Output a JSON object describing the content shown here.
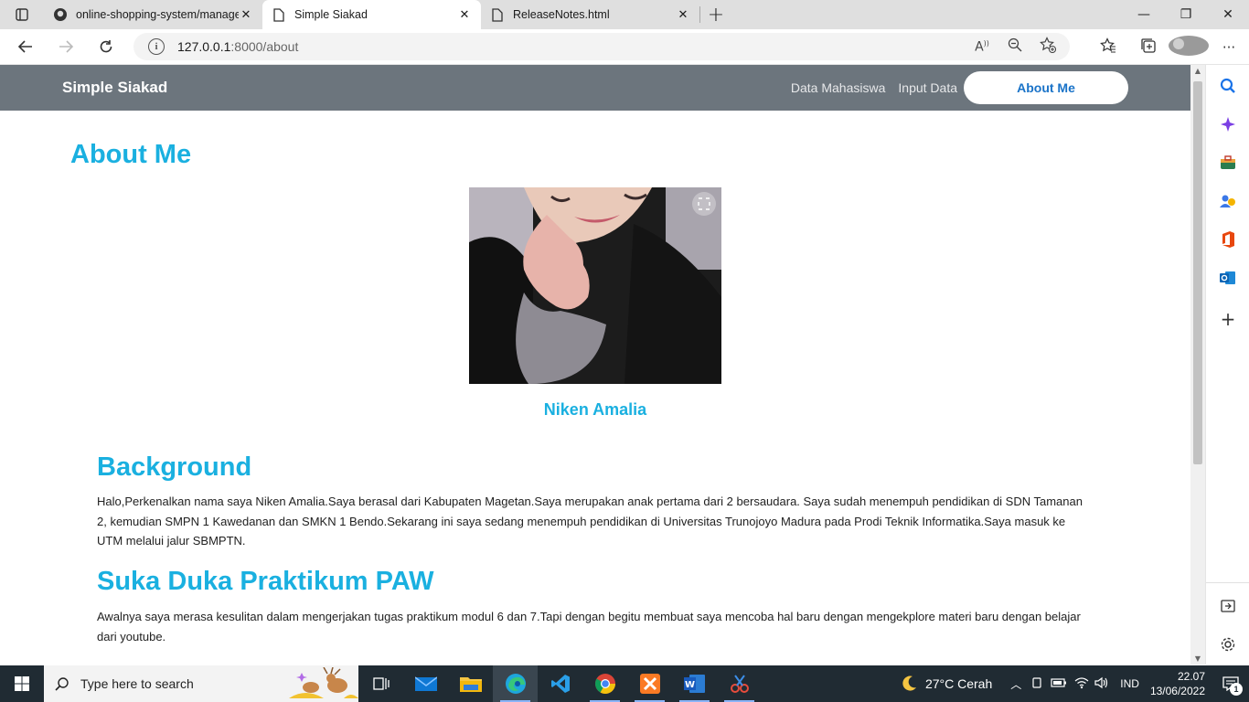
{
  "browser": {
    "tabs": [
      {
        "title": "online-shopping-system/manage",
        "icon": "github-icon"
      },
      {
        "title": "Simple Siakad",
        "icon": "page-icon",
        "active": true
      },
      {
        "title": "ReleaseNotes.html",
        "icon": "page-icon"
      }
    ],
    "tab_close": "✕",
    "new_tab": "+",
    "url_host": "127.0.0.1",
    "url_rest": ":8000/about",
    "window_controls": {
      "minimize": "—",
      "maximize": "❐",
      "close": "✕"
    }
  },
  "navbar": {
    "brand": "Simple Siakad",
    "links": [
      "Data Mahasiswa",
      "Input Data"
    ],
    "active_link": "About Me",
    "bg_color": "#6c757d"
  },
  "page": {
    "title": "About Me",
    "photo_caption": "Niken Amalia",
    "accent_color": "#1ab0e0",
    "sections": [
      {
        "title": "Background",
        "text": "Halo,Perkenalkan nama saya Niken Amalia.Saya berasal dari Kabupaten Magetan.Saya merupakan anak pertama dari 2 bersaudara. Saya sudah menempuh pendidikan di SDN Tamanan 2, kemudian SMPN 1 Kawedanan dan SMKN 1 Bendo.Sekarang ini saya sedang menempuh pendidikan di Universitas Trunojoyo Madura pada Prodi Teknik Informatika.Saya masuk ke UTM melalui jalur SBMPTN."
      },
      {
        "title": "Suka Duka Praktikum PAW",
        "text": "Awalnya saya merasa kesulitan dalam mengerjakan tugas praktikum modul 6 dan 7.Tapi dengan begitu membuat saya mencoba hal baru dengan mengekplore materi baru dengan belajar dari youtube."
      }
    ]
  },
  "taskbar": {
    "search_placeholder": "Type here to search",
    "weather": "27°C  Cerah",
    "language": "IND",
    "time": "22.07",
    "date": "13/06/2022",
    "notification_count": "1"
  }
}
